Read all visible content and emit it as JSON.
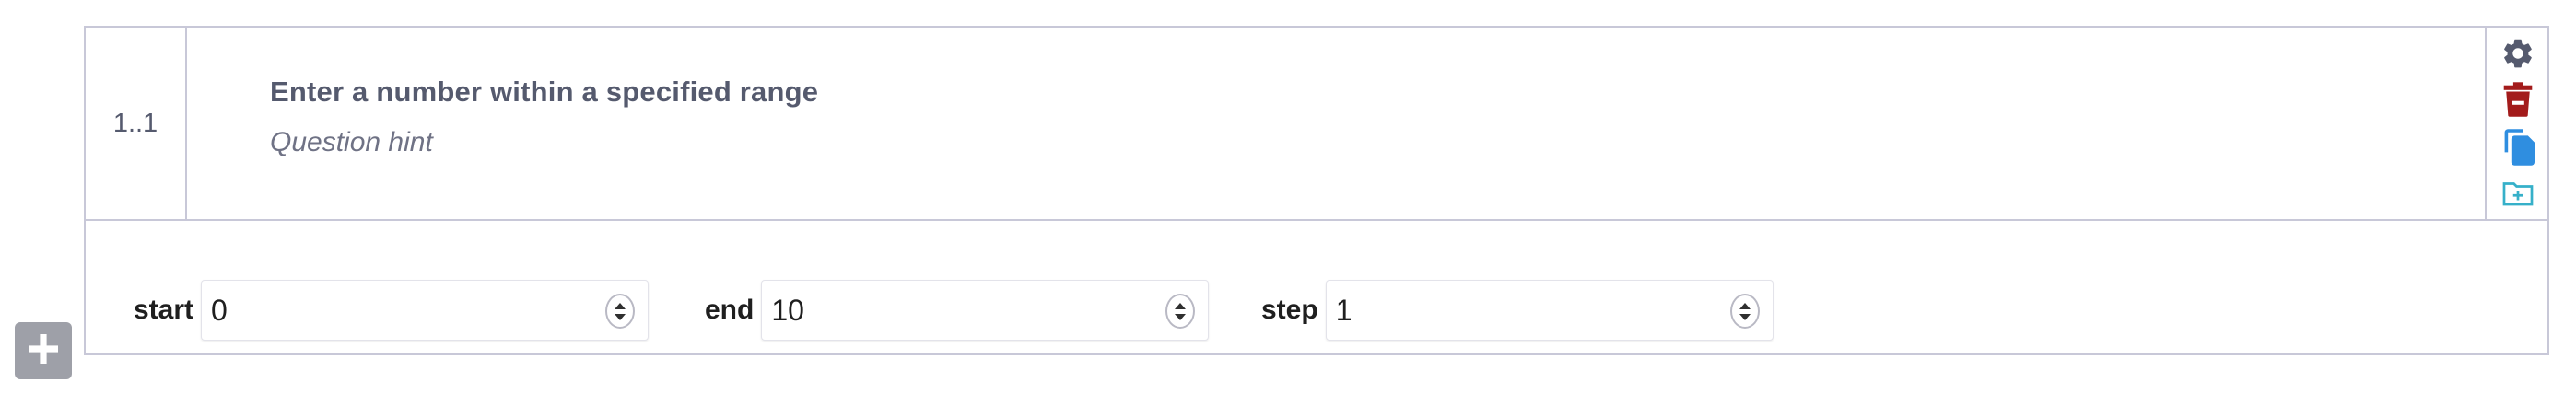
{
  "question": {
    "number": "1..1",
    "title": "Enter a number within a specified range",
    "hint": "Question hint"
  },
  "actions": {
    "settings_icon": "gear-icon",
    "delete_icon": "trash-icon",
    "duplicate_icon": "copy-icon",
    "add_to_library_icon": "folder-plus-icon",
    "colors": {
      "settings": "#555a6e",
      "delete": "#a31b1b",
      "duplicate": "#2f8ee0",
      "add_to_library": "#36b0c9"
    }
  },
  "range": {
    "start_label": "start",
    "start_value": "0",
    "end_label": "end",
    "end_value": "10",
    "step_label": "step",
    "step_value": "1"
  },
  "add_button": {
    "icon": "plus-icon",
    "color": "#9ea0a8"
  }
}
